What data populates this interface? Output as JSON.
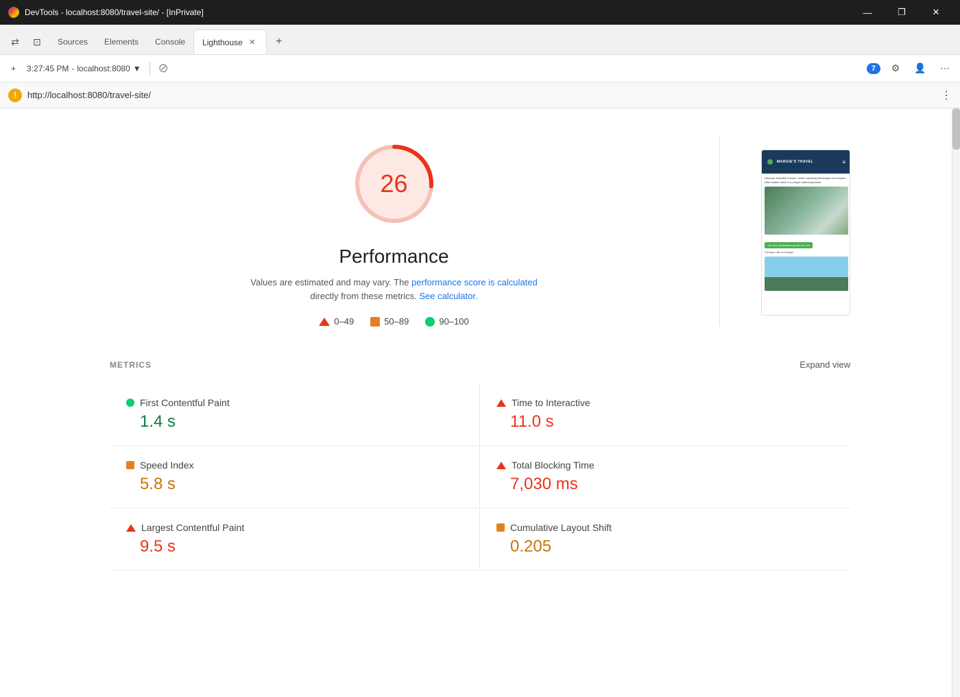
{
  "titlebar": {
    "title": "DevTools - localhost:8080/travel-site/ - [InPrivate]",
    "minimize": "—",
    "restore": "❐",
    "close": "✕"
  },
  "tabs": {
    "inactive1": "Sources",
    "inactive2": "Elements",
    "inactive3": "Console",
    "active": "Lighthouse",
    "add": "+"
  },
  "devtools_toolbar": {
    "time": "3:27:45 PM",
    "host": "localhost:8080",
    "notification_count": "7"
  },
  "address": {
    "url": "http://localhost:8080/travel-site/"
  },
  "performance": {
    "score": "26",
    "title": "Performance",
    "description": "Values are estimated and may vary. The",
    "link1": "performance score\nis calculated",
    "description2": "directly from these metrics.",
    "link2": "See calculator.",
    "legend": {
      "low_range": "0–49",
      "mid_range": "50–89",
      "high_range": "90–100"
    }
  },
  "metrics": {
    "title": "METRICS",
    "expand": "Expand view",
    "items": [
      {
        "name": "First Contentful Paint",
        "value": "1.4 s",
        "status": "green",
        "icon": "circle"
      },
      {
        "name": "Time to Interactive",
        "value": "11.0 s",
        "status": "red",
        "icon": "triangle"
      },
      {
        "name": "Speed Index",
        "value": "5.8 s",
        "status": "orange",
        "icon": "square"
      },
      {
        "name": "Total Blocking Time",
        "value": "7,030 ms",
        "status": "red",
        "icon": "triangle"
      },
      {
        "name": "Largest Contentful Paint",
        "value": "9.5 s",
        "status": "red",
        "icon": "triangle"
      },
      {
        "name": "Cumulative Layout Shift",
        "value": "0.205",
        "status": "orange",
        "icon": "square"
      }
    ]
  },
  "screenshot": {
    "site_name": "MARGIE'S TRAVEL",
    "hero_text": "Discover beautiful Corcise, where stunning landscapes and crystal clear waters meet in a unique natural paradise",
    "btn_text": "Our best destination guides for you",
    "bottom_text": "Subregion hills and villages"
  }
}
